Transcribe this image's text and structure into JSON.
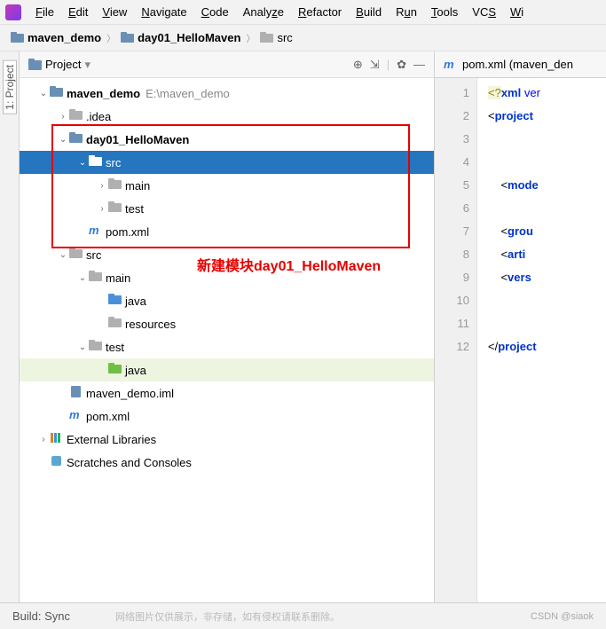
{
  "menu": [
    "File",
    "Edit",
    "View",
    "Navigate",
    "Code",
    "Analyze",
    "Refactor",
    "Build",
    "Run",
    "Tools",
    "VCS",
    "Wi"
  ],
  "breadcrumb": [
    {
      "icon": "folder-root",
      "label": "maven_demo",
      "bold": true
    },
    {
      "icon": "folder",
      "label": "day01_HelloMaven",
      "bold": true
    },
    {
      "icon": "folder",
      "label": "src",
      "bold": false
    }
  ],
  "sidebar_tab": "1: Project",
  "panel": {
    "title": "Project"
  },
  "tree": [
    {
      "indent": 0,
      "arrow": "down",
      "icon": "folder-root",
      "label": "maven_demo",
      "bold": true,
      "path": "E:\\maven_demo"
    },
    {
      "indent": 1,
      "arrow": "right",
      "icon": "folder",
      "label": ".idea"
    },
    {
      "indent": 1,
      "arrow": "down",
      "icon": "folder-mod",
      "label": "day01_HelloMaven",
      "bold": true
    },
    {
      "indent": 2,
      "arrow": "down",
      "icon": "folder",
      "label": "src",
      "selected": true
    },
    {
      "indent": 3,
      "arrow": "right",
      "icon": "folder",
      "label": "main"
    },
    {
      "indent": 3,
      "arrow": "right",
      "icon": "folder",
      "label": "test"
    },
    {
      "indent": 2,
      "arrow": "",
      "icon": "pom",
      "label": "pom.xml"
    },
    {
      "indent": 1,
      "arrow": "down",
      "icon": "folder",
      "label": "src"
    },
    {
      "indent": 2,
      "arrow": "down",
      "icon": "folder",
      "label": "main"
    },
    {
      "indent": 3,
      "arrow": "",
      "icon": "folder-src",
      "label": "java"
    },
    {
      "indent": 3,
      "arrow": "",
      "icon": "folder-res",
      "label": "resources"
    },
    {
      "indent": 2,
      "arrow": "down",
      "icon": "folder",
      "label": "test",
      "highlighted": false
    },
    {
      "indent": 3,
      "arrow": "",
      "icon": "folder-test",
      "label": "java",
      "highlighted": true
    },
    {
      "indent": 1,
      "arrow": "",
      "icon": "iml",
      "label": "maven_demo.iml"
    },
    {
      "indent": 1,
      "arrow": "",
      "icon": "pom",
      "label": "pom.xml"
    },
    {
      "indent": 0,
      "arrow": "right",
      "icon": "lib",
      "label": "External Libraries"
    },
    {
      "indent": 0,
      "arrow": "",
      "icon": "scratch",
      "label": "Scratches and Consoles"
    }
  ],
  "annotation": "新建模块day01_HelloMaven",
  "editor": {
    "tab": "pom.xml (maven_den",
    "lines": [
      {
        "n": 1,
        "html": "<span class='cm-decl'>&lt;?</span><span class='cm-tag'>xml</span> <span class='cm-attr'>ver</span>"
      },
      {
        "n": 2,
        "html": "&lt;<span class='cm-tag'>project</span> "
      },
      {
        "n": 3,
        "html": ""
      },
      {
        "n": 4,
        "html": ""
      },
      {
        "n": 5,
        "html": "    &lt;<span class='cm-tag'>mode</span>"
      },
      {
        "n": 6,
        "html": ""
      },
      {
        "n": 7,
        "html": "    &lt;<span class='cm-tag'>grou</span>"
      },
      {
        "n": 8,
        "html": "    &lt;<span class='cm-tag'>arti</span>"
      },
      {
        "n": 9,
        "html": "    &lt;<span class='cm-tag'>vers</span>"
      },
      {
        "n": 10,
        "html": ""
      },
      {
        "n": 11,
        "html": ""
      },
      {
        "n": 12,
        "html": "&lt;/<span class='cm-tag'>project</span>"
      }
    ]
  },
  "status": {
    "left": "Build:   Sync",
    "watermark": "网络图片仅供展示，非存储，如有侵权请联系删除。",
    "right": "CSDN @siaok"
  }
}
